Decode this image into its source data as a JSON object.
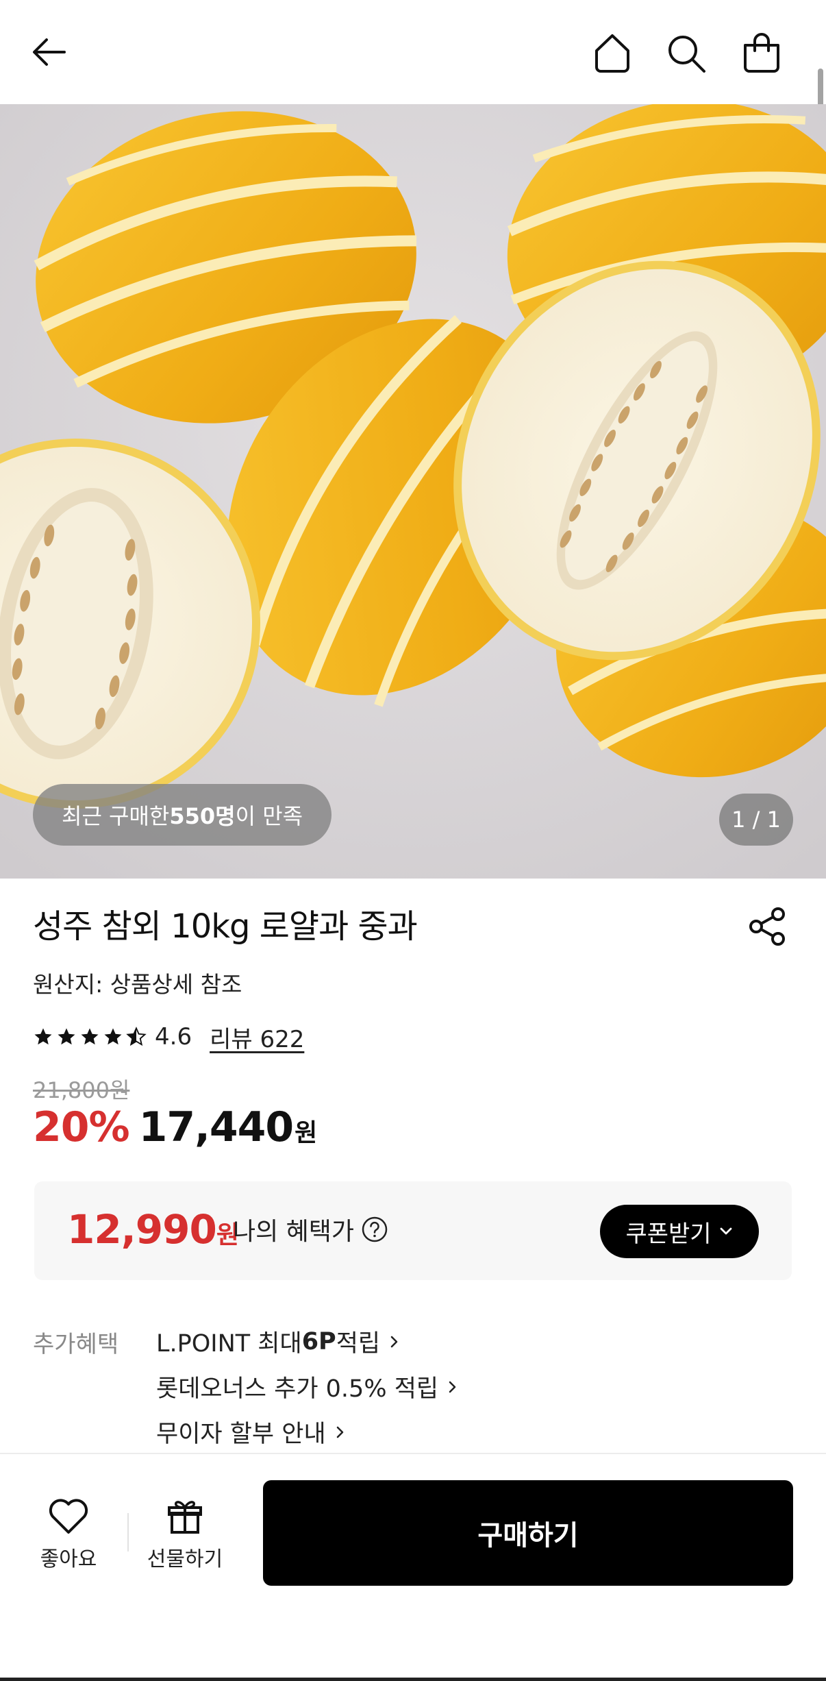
{
  "nav": {
    "back_icon": "arrow-left-icon",
    "home_icon": "home-icon",
    "search_icon": "search-icon",
    "cart_icon": "shopping-bag-icon"
  },
  "hero": {
    "satisfaction_prefix": "최근 구매한 ",
    "satisfaction_count": "550명",
    "satisfaction_suffix": "이 만족",
    "page_indicator": "1 / 1"
  },
  "product": {
    "title": "성주 참외 10kg 로얄과 중과",
    "origin": "원산지: 상품상세 참조",
    "rating": "4.6",
    "rating_value": 4.6,
    "review_label": "리뷰 622",
    "original_price": "21,800원",
    "discount": "20%",
    "price": "17,440",
    "price_unit": "원"
  },
  "benefit": {
    "price": "12,990",
    "price_unit": "원",
    "label": "나의 혜택가",
    "coupon_button": "쿠폰받기"
  },
  "extra_benefits": {
    "label": "추가혜택",
    "lpoint_prefix": "L.POINT 최대 ",
    "lpoint_bold": "6P",
    "lpoint_suffix": " 적립",
    "lotte_onus": "롯데오너스 추가 0.5% 적립",
    "installment": "무이자 할부 안내"
  },
  "bottom_bar": {
    "like_label": "좋아요",
    "gift_label": "선물하기",
    "buy_label": "구매하기"
  },
  "colors": {
    "accent_red": "#d6302f",
    "button_black": "#000000",
    "melon_yellow": "#f2b51b"
  }
}
